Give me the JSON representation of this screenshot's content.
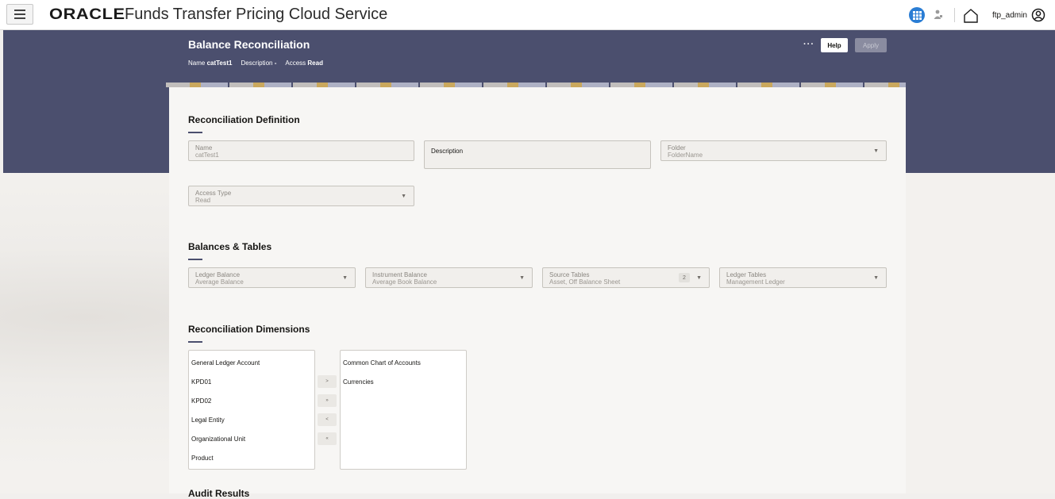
{
  "header": {
    "menu_icon": "hamburger-icon",
    "logo_text": "ORACLE",
    "app_title": "Funds Transfer Pricing Cloud Service",
    "username": "ftp_admin",
    "icons": [
      "apps-grid-icon",
      "person-icon",
      "home-icon",
      "user-avatar-icon"
    ]
  },
  "page": {
    "title": "Balance Reconciliation",
    "meta": {
      "name_label": "Name",
      "name_value": "catTest1",
      "description_label": "Description",
      "description_value": "-",
      "access_label": "Access",
      "access_value": "Read"
    },
    "more_label": "···",
    "help_label": "Help",
    "apply_label": "Apply"
  },
  "definition": {
    "heading": "Reconciliation Definition",
    "name": {
      "label": "Name",
      "value": "catTest1"
    },
    "description": {
      "label": "Description",
      "value": ""
    },
    "folder": {
      "label": "Folder",
      "value": "FolderName"
    },
    "access_type": {
      "label": "Access Type",
      "value": "Read"
    }
  },
  "balances": {
    "heading": "Balances & Tables",
    "ledger_balance": {
      "label": "Ledger Balance",
      "value": "Average Balance"
    },
    "instrument_balance": {
      "label": "Instrument Balance",
      "value": "Average Book Balance"
    },
    "source_tables": {
      "label": "Source Tables",
      "value": "Asset, Off Balance Sheet",
      "count": "2"
    },
    "ledger_tables": {
      "label": "Ledger Tables",
      "value": "Management Ledger"
    }
  },
  "dimensions": {
    "heading": "Reconciliation Dimensions",
    "available": [
      "General Ledger Account",
      "KPD01",
      "KPD02",
      "Legal Entity",
      "Organizational Unit",
      "Product"
    ],
    "selected": [
      "Common Chart of Accounts",
      "Currencies"
    ],
    "buttons": [
      ">",
      "»",
      "<",
      "«"
    ]
  },
  "next_section": {
    "heading": "Audit Results"
  },
  "colors": {
    "banner": "#4b4f6e",
    "accent_blue": "#2a7dd4",
    "panel": "#f7f6f4"
  }
}
